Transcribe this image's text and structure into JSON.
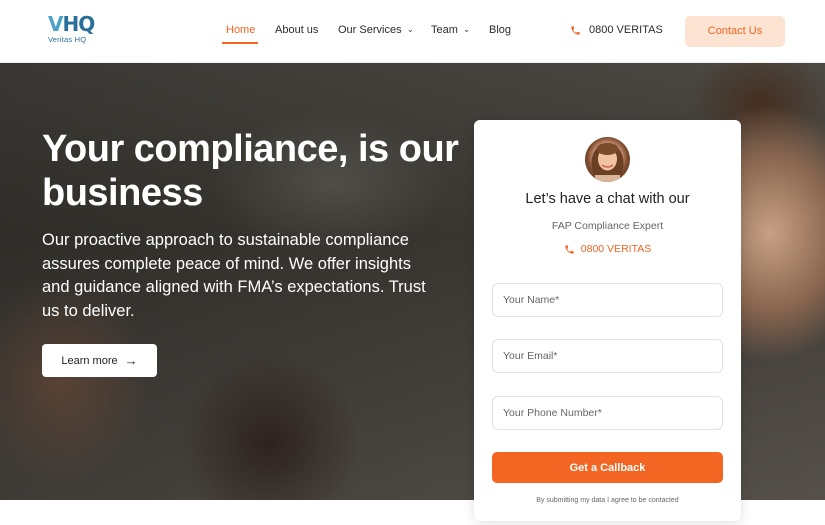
{
  "header": {
    "logo_mark": "VHQ",
    "logo_text": "Veritas HQ",
    "nav": [
      {
        "label": "Home",
        "active": true
      },
      {
        "label": "About us"
      },
      {
        "label": "Our Services",
        "dropdown": true
      },
      {
        "label": "Team",
        "dropdown": true
      },
      {
        "label": "Blog"
      }
    ],
    "phone": "0800 VERITAS",
    "contact_label": "Contact Us"
  },
  "hero": {
    "title": "Your compliance, is our business",
    "text": "Our proactive approach to sustainable compliance assures complete peace of mind. We offer insights and guidance aligned with FMA’s expectations. Trust us to deliver.",
    "button_label": "Learn more"
  },
  "form": {
    "title": "Let’s have a chat with our",
    "subtitle": "FAP Compliance Expert",
    "phone": "0800 VERITAS",
    "name_placeholder": "Your Name*",
    "email_placeholder": "Your Email*",
    "phone_placeholder": "Your Phone Number*",
    "submit_label": "Get a Callback",
    "disclaimer": "By submitting my data I agree to be contacted"
  },
  "colors": {
    "accent": "#f26522",
    "accent_light": "#fde3d2",
    "brand": "#2a6e9a"
  }
}
